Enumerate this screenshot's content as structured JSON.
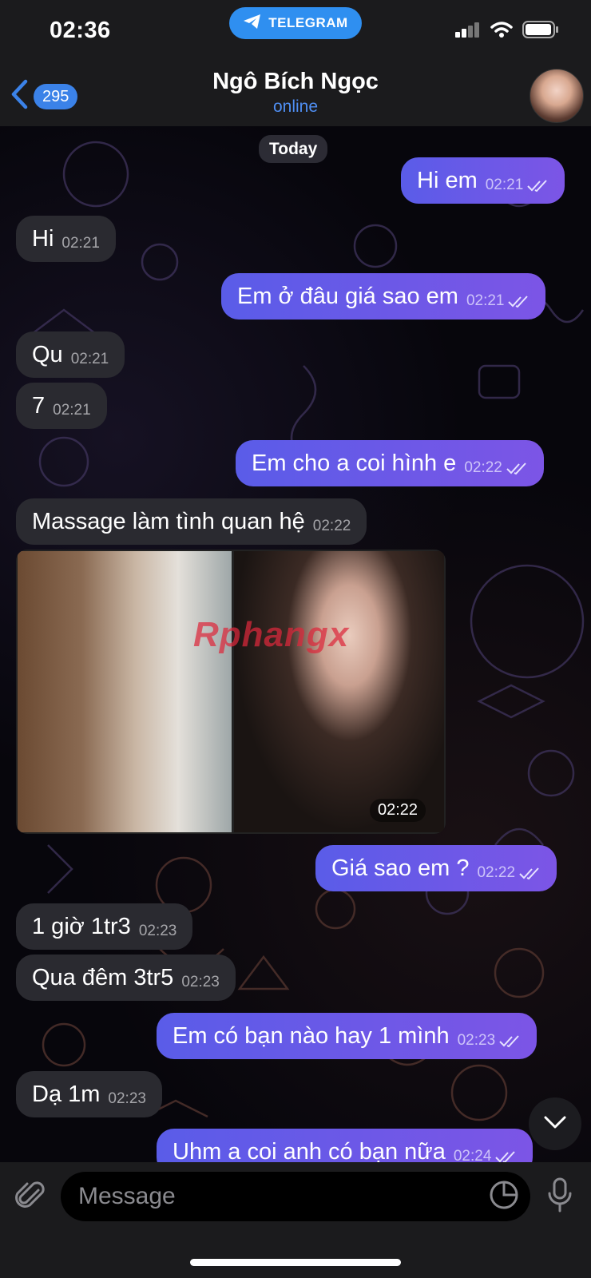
{
  "status_bar": {
    "time": "02:36",
    "app_pill": "TELEGRAM"
  },
  "header": {
    "back_count": "295",
    "name": "Ngô Bích Ngọc",
    "status": "online"
  },
  "date_chip": "Today",
  "messages": [
    {
      "dir": "out",
      "text": "Hi em",
      "time": "02:21"
    },
    {
      "dir": "in",
      "text": "Hi",
      "time": "02:21"
    },
    {
      "dir": "out",
      "text": "Em ở đâu giá sao em",
      "time": "02:21"
    },
    {
      "dir": "in",
      "text": "Qu",
      "time": "02:21"
    },
    {
      "dir": "in",
      "text": "7",
      "time": "02:21"
    },
    {
      "dir": "out",
      "text": "Em cho a coi hình e",
      "time": "02:22"
    },
    {
      "dir": "in",
      "text": "Massage làm tình quan hệ",
      "time": "02:22"
    },
    {
      "dir": "out",
      "text": "Giá sao em ?",
      "time": "02:22"
    },
    {
      "dir": "in",
      "text": "1 giờ 1tr3",
      "time": "02:23"
    },
    {
      "dir": "in",
      "text": "Qua đêm 3tr5",
      "time": "02:23"
    },
    {
      "dir": "out",
      "text": "Em có bạn nào hay 1 mình",
      "time": "02:23"
    },
    {
      "dir": "in",
      "text": "Dạ 1m",
      "time": "02:23"
    },
    {
      "dir": "out",
      "text": "Uhm a coi anh có bạn nữa",
      "time": "02:24"
    }
  ],
  "album": {
    "time": "02:22",
    "watermark": "Rphangx"
  },
  "input": {
    "placeholder": "Message"
  },
  "colors": {
    "accent": "#3b82e8",
    "outgoing": "#6b58e8",
    "incoming": "#2a2a30"
  }
}
